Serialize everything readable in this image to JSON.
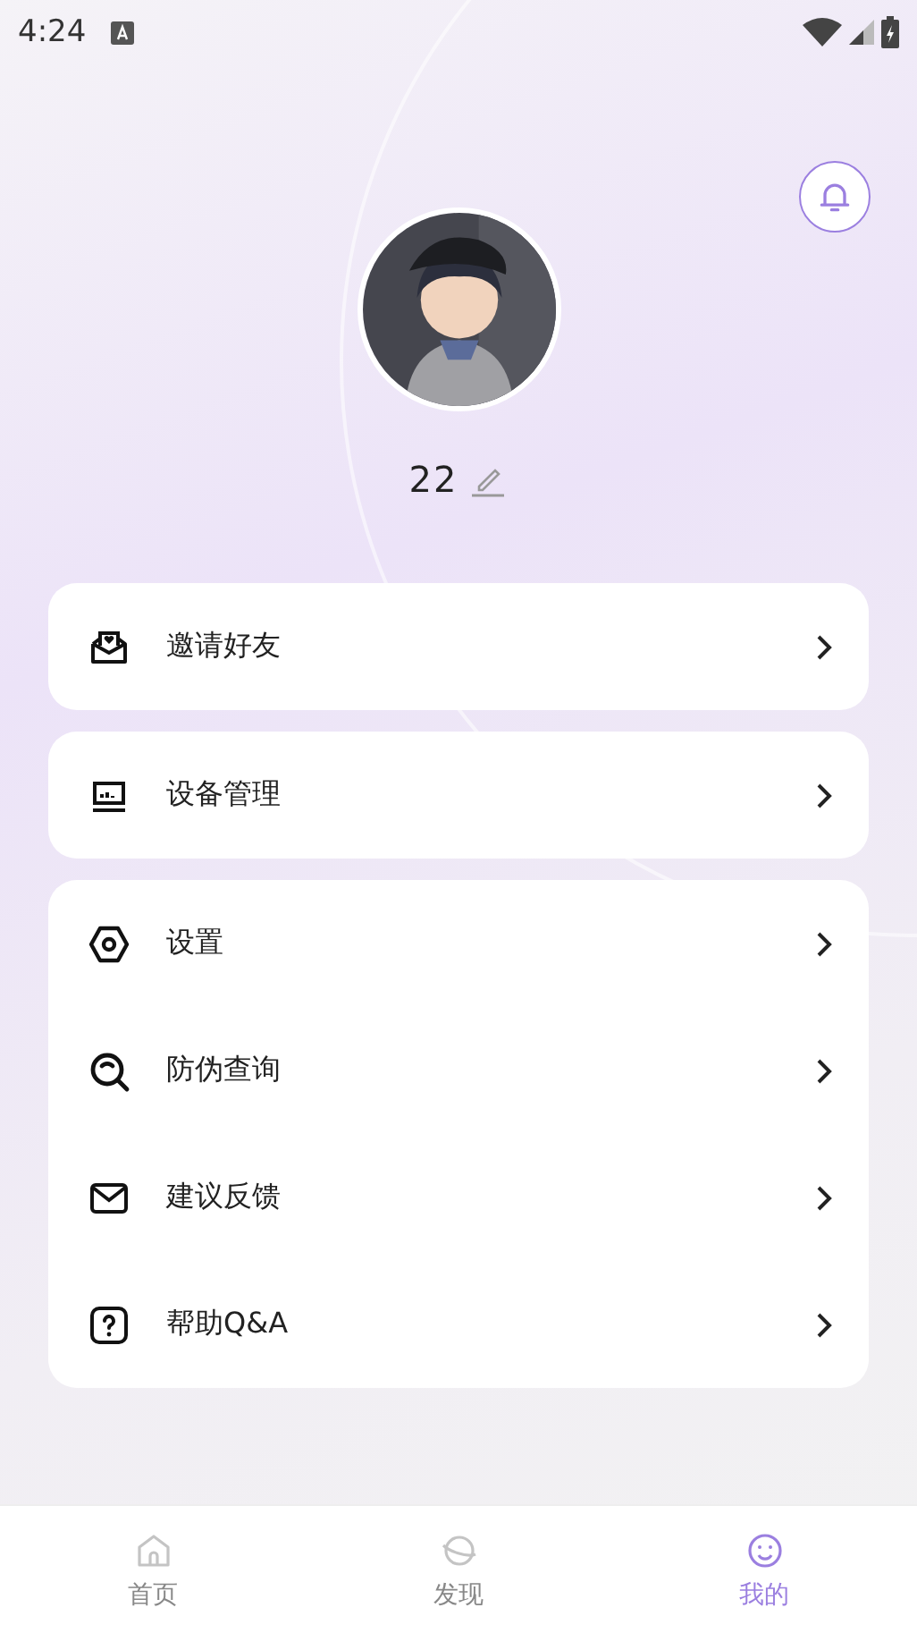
{
  "status_bar": {
    "time": "4:24"
  },
  "profile": {
    "name": "22"
  },
  "menu_groups": [
    {
      "items": [
        {
          "label": "邀请好友",
          "kind": "invite"
        }
      ]
    },
    {
      "items": [
        {
          "label": "设备管理",
          "kind": "device"
        }
      ]
    },
    {
      "items": [
        {
          "label": "设置",
          "kind": "settings"
        },
        {
          "label": "防伪查询",
          "kind": "verify"
        },
        {
          "label": "建议反馈",
          "kind": "feedback"
        },
        {
          "label": "帮助Q&A",
          "kind": "help"
        }
      ]
    }
  ],
  "bottom_nav": [
    {
      "label": "首页",
      "kind": "home",
      "selected": false
    },
    {
      "label": "发现",
      "kind": "discover",
      "selected": false
    },
    {
      "label": "我的",
      "kind": "profile",
      "selected": true
    }
  ]
}
